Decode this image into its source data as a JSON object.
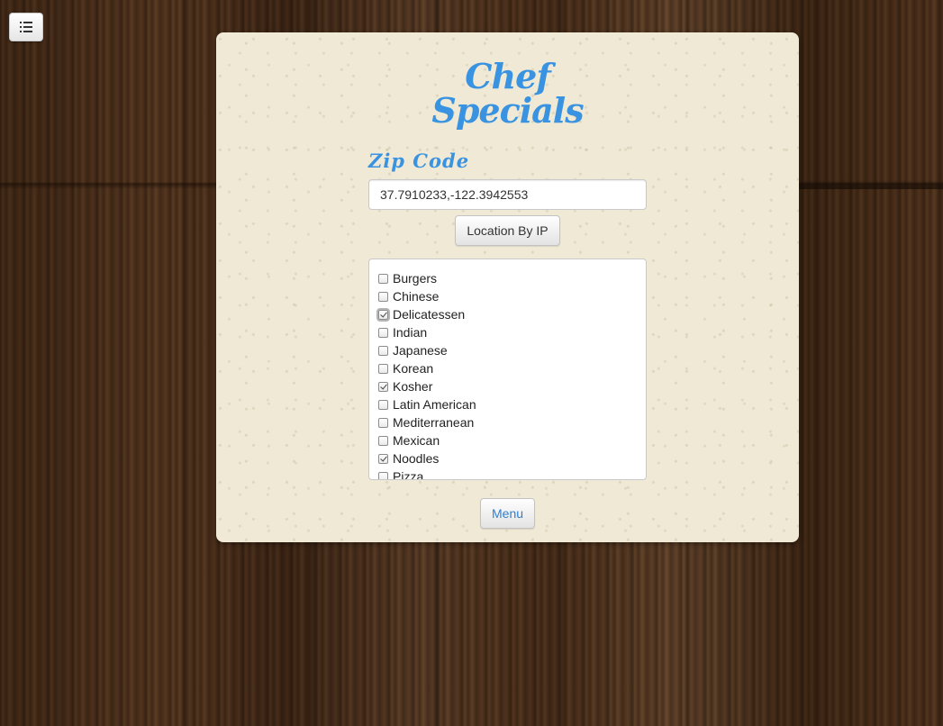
{
  "menu_toggle": {
    "icon": "list-icon"
  },
  "header": {
    "title_line1": "Chef",
    "title_line2": "Specials"
  },
  "zip": {
    "label": "Zip Code",
    "value": "37.7910233,-122.3942553"
  },
  "location_button": {
    "label": "Location By IP"
  },
  "cuisines": [
    {
      "label": "Burgers",
      "checked": false
    },
    {
      "label": "Chinese",
      "checked": false
    },
    {
      "label": "Delicatessen",
      "checked": true,
      "focused": true
    },
    {
      "label": "Indian",
      "checked": false
    },
    {
      "label": "Japanese",
      "checked": false
    },
    {
      "label": "Korean",
      "checked": false
    },
    {
      "label": "Kosher",
      "checked": true
    },
    {
      "label": "Latin American",
      "checked": false
    },
    {
      "label": "Mediterranean",
      "checked": false
    },
    {
      "label": "Mexican",
      "checked": false
    },
    {
      "label": "Noodles",
      "checked": true
    },
    {
      "label": "Pizza",
      "checked": false
    }
  ],
  "menu_button": {
    "label": "Menu"
  },
  "colors": {
    "accent": "#3a93e0",
    "card_bg": "#efe9d6",
    "wood": "#4a2f1c"
  }
}
